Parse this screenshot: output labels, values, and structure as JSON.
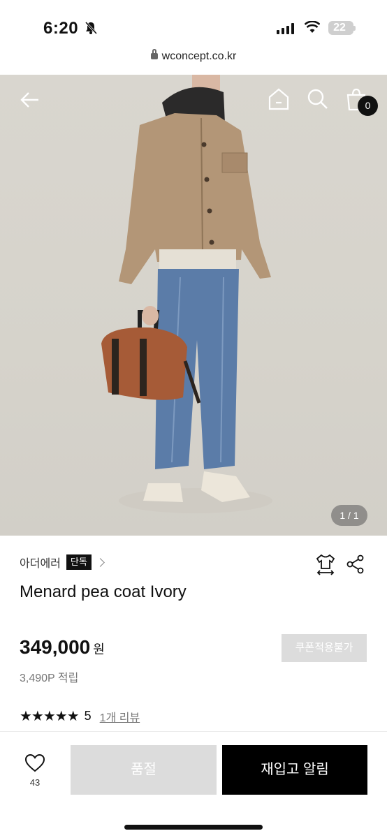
{
  "status_bar": {
    "time": "6:20",
    "battery": "22"
  },
  "browser": {
    "url": "wconcept.co.kr"
  },
  "gallery": {
    "counter": "1 / 1",
    "cart_count": "0"
  },
  "product": {
    "brand": "아더에러",
    "brand_tag": "단독",
    "name": "Menard pea coat Ivory",
    "price": "349,000",
    "currency": "원",
    "points": "3,490P 적립",
    "coupon_label": "쿠폰적용불가",
    "stars": "★★★★★",
    "rating": "5",
    "review_link": "1개 리뷰"
  },
  "bottom_bar": {
    "like_count": "43",
    "soldout_label": "품절",
    "restock_label": "재입고 알림"
  }
}
